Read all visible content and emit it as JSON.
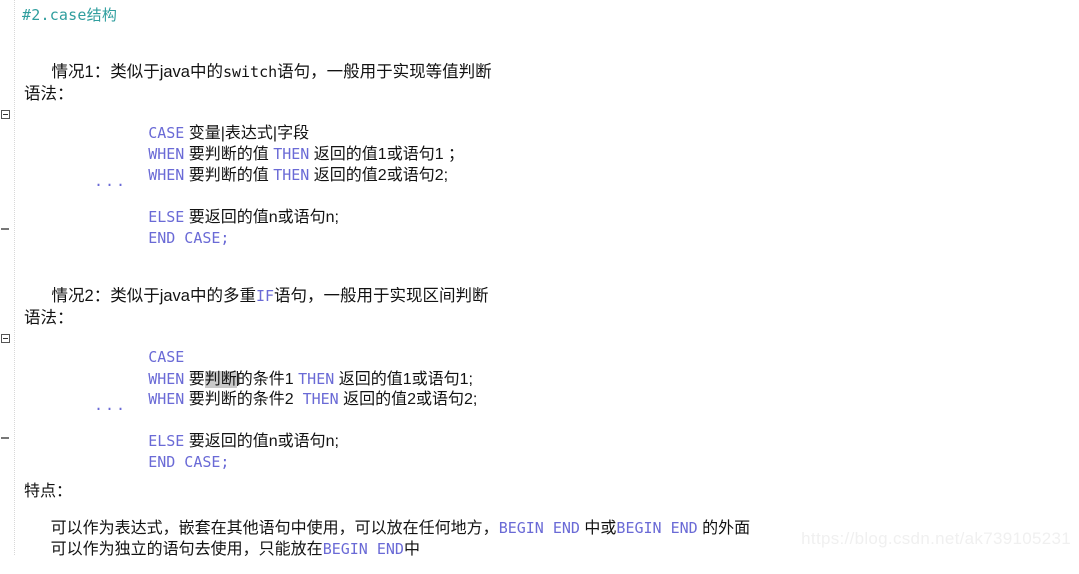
{
  "document": {
    "heading": "#2.case结构",
    "watermark": "https://blog.csdn.net/ak739105231"
  },
  "section1": {
    "intro_prefix": "情况1：类似于java中的",
    "intro_keyword": "switch",
    "intro_suffix": "语句，一般用于实现等值判断",
    "syntax_label": "语法：",
    "code": {
      "l1_kw": "CASE",
      "l1_text": " 变量|表达式|字段",
      "l2_kw1": "WHEN",
      "l2_t1": " 要判断的值 ",
      "l2_kw2": "THEN",
      "l2_t2": " 返回的值1或语句1 ；",
      "l3_kw1": "WHEN",
      "l3_t1": " 要判断的值 ",
      "l3_kw2": "THEN",
      "l3_t2": " 返回的值2或语句2;",
      "l4_dots": "...",
      "l5_kw": "ELSE",
      "l5_text": " 要返回的值n或语句n;",
      "l6_kw": "END CASE;"
    }
  },
  "section2": {
    "intro_prefix": "情况2：类似于java中的多重",
    "intro_keyword": "IF",
    "intro_suffix": "语句，一般用于实现区间判断",
    "syntax_label": "语法：",
    "code": {
      "l1_kw": "CASE",
      "l2_kw1": "WHEN",
      "l2_sel_pre": " 要",
      "l2_sel": "判断",
      "l2_sel_post": "的条件1 ",
      "l2_kw2": "THEN",
      "l2_t2": " 返回的值1或语句1;",
      "l3_kw1": "WHEN",
      "l3_t1": " 要判断的条件2  ",
      "l3_kw2": "THEN",
      "l3_t2": " 返回的值2或语句2;",
      "l4_dots": "...",
      "l5_kw": "ELSE",
      "l5_text": " 要返回的值n或语句n;",
      "l6_kw": "END CASE;"
    }
  },
  "features": {
    "label": "特点：",
    "line1_a": "可以作为表达式，嵌套在其他语句中使用，可以放在任何地方，",
    "line1_kw1": "BEGIN END",
    "line1_b": " 中或",
    "line1_kw2": "BEGIN END",
    "line1_c": " 的外面",
    "line2_a": "可以作为独立的语句去使用，只能放在",
    "line2_kw": "BEGIN END",
    "line2_b": "中"
  }
}
